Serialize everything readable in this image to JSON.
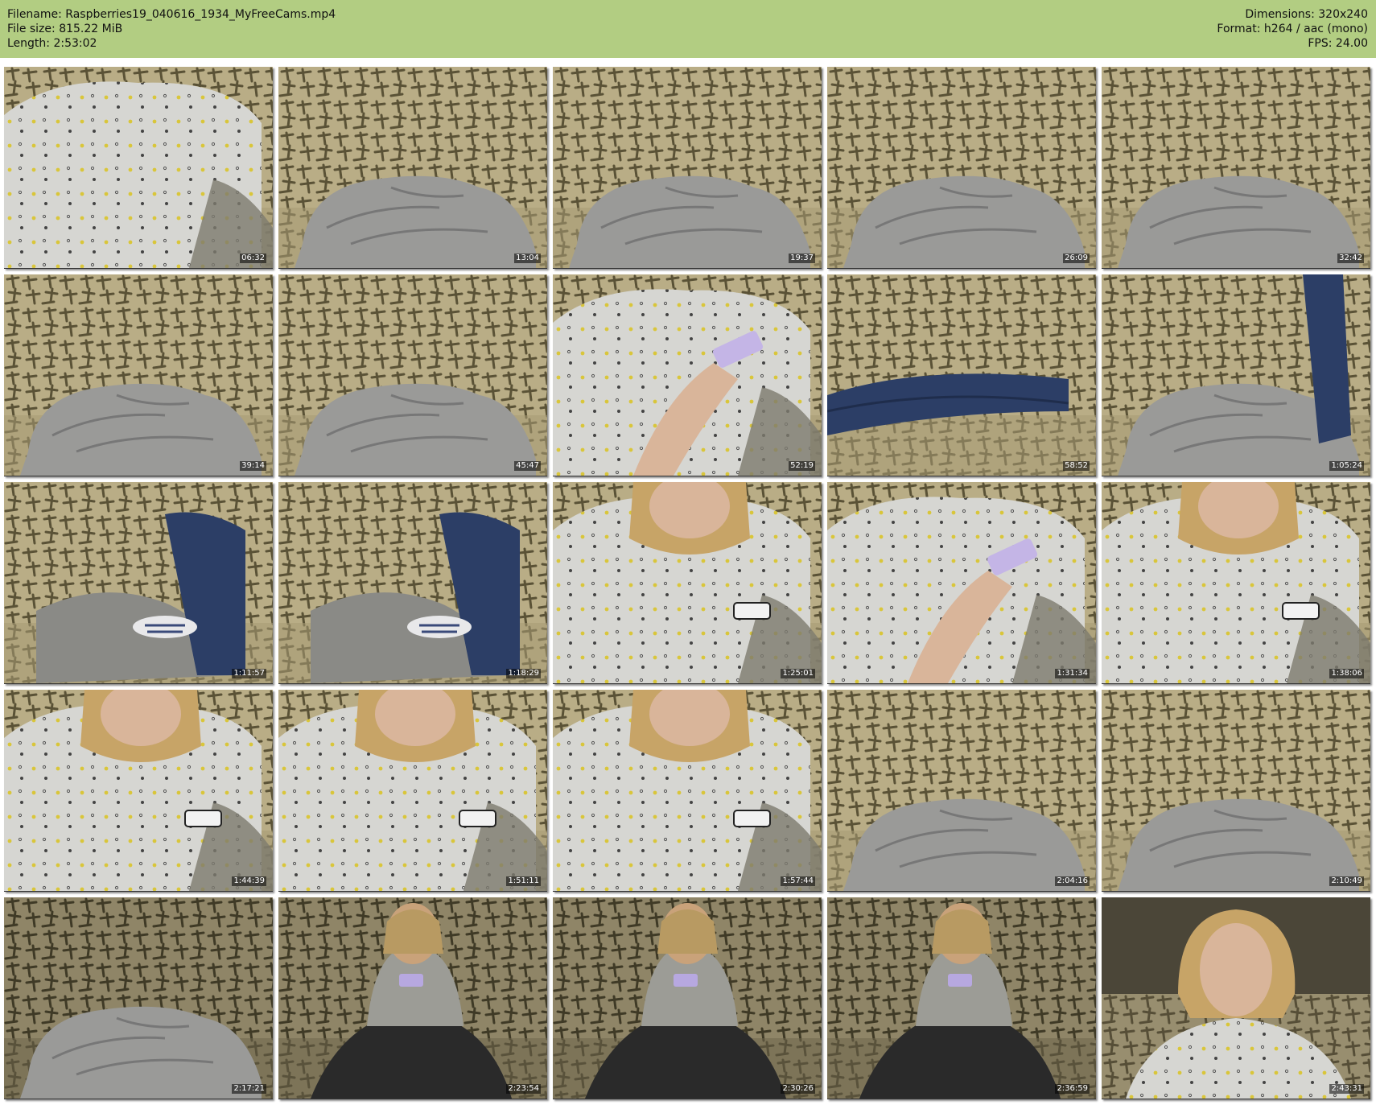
{
  "header": {
    "filename_line": "Filename: Raspberries19_040616_1934_MyFreeCams.mp4",
    "filesize_line": "File size: 815.22 MiB",
    "length_line": "Length: 2:53:02",
    "dimensions_line": "Dimensions: 320x240",
    "format_line": "Format: h264 / aac (mono)",
    "fps_line": "FPS: 24.00",
    "bar_color": "#b2cd82"
  },
  "frames": [
    {
      "time": "06:32",
      "scene": "person-shirt"
    },
    {
      "time": "13:04",
      "scene": "blanket"
    },
    {
      "time": "19:37",
      "scene": "blanket"
    },
    {
      "time": "26:09",
      "scene": "blanket"
    },
    {
      "time": "32:42",
      "scene": "blanket"
    },
    {
      "time": "39:14",
      "scene": "blanket"
    },
    {
      "time": "45:47",
      "scene": "blanket"
    },
    {
      "time": "52:19",
      "scene": "person-phone"
    },
    {
      "time": "58:52",
      "scene": "legs"
    },
    {
      "time": "1:05:24",
      "scene": "blanket-leg"
    },
    {
      "time": "1:11:57",
      "scene": "legs-socks"
    },
    {
      "time": "1:18:29",
      "scene": "legs-socks"
    },
    {
      "time": "1:25:01",
      "scene": "person-head"
    },
    {
      "time": "1:31:34",
      "scene": "person-phone"
    },
    {
      "time": "1:38:06",
      "scene": "person-head"
    },
    {
      "time": "1:44:39",
      "scene": "person-side"
    },
    {
      "time": "1:51:11",
      "scene": "person-head"
    },
    {
      "time": "1:57:44",
      "scene": "person-head"
    },
    {
      "time": "2:04:16",
      "scene": "blanket"
    },
    {
      "time": "2:10:49",
      "scene": "blanket"
    },
    {
      "time": "2:17:21",
      "scene": "blanket-dark"
    },
    {
      "time": "2:23:54",
      "scene": "person-dark"
    },
    {
      "time": "2:30:26",
      "scene": "person-dark"
    },
    {
      "time": "2:36:59",
      "scene": "person-dark"
    },
    {
      "time": "2:43:31",
      "scene": "person-face"
    }
  ]
}
